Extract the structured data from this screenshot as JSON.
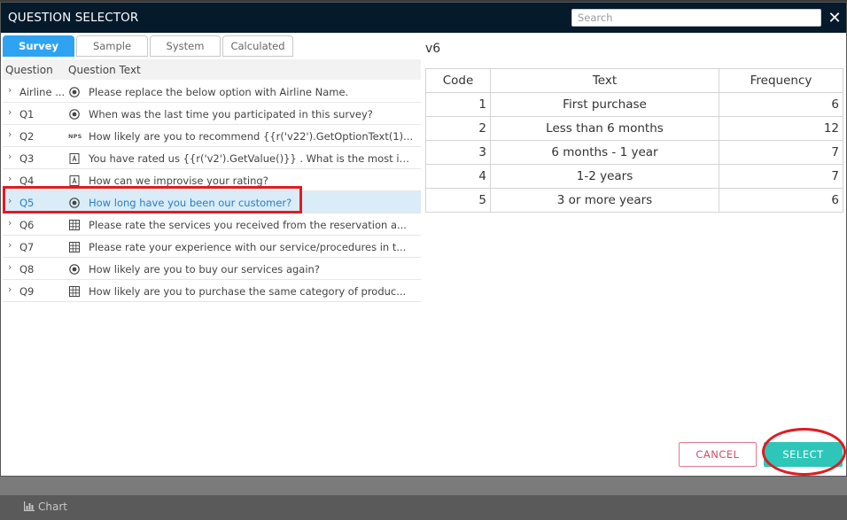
{
  "window": {
    "title": "QUESTION SELECTOR"
  },
  "search": {
    "placeholder": "Search",
    "value": ""
  },
  "close_icon": "close-icon",
  "tabs": [
    {
      "label": "Survey",
      "active": true
    },
    {
      "label": "Sample",
      "active": false
    },
    {
      "label": "System",
      "active": false
    },
    {
      "label": "Calculated",
      "active": false
    }
  ],
  "list": {
    "headers": {
      "question": "Question",
      "text": "Question Text"
    },
    "rows": [
      {
        "id": "Airline ...",
        "icon": "radio-icon",
        "text": "Please replace the below option with Airline Name."
      },
      {
        "id": "Q1",
        "icon": "radio-icon",
        "text": "When was the last time you participated in this survey?"
      },
      {
        "id": "Q2",
        "icon": "nps-icon",
        "icon_label": "NPS",
        "text": "How likely are you to recommend {{r('v22').GetOptionText(1)..."
      },
      {
        "id": "Q3",
        "icon": "text-field-icon",
        "text": "You have rated us {{r('v2').GetValue()}} . What is the most im..."
      },
      {
        "id": "Q4",
        "icon": "text-field-icon",
        "text": "How can we improvise your rating?"
      },
      {
        "id": "Q5",
        "icon": "radio-icon",
        "text": "How long have you been our customer?",
        "selected": true
      },
      {
        "id": "Q6",
        "icon": "grid-icon",
        "text": " Please rate the services you received from the reservation a..."
      },
      {
        "id": "Q7",
        "icon": "grid-icon",
        "text": "Please rate your experience with our service/procedures in t..."
      },
      {
        "id": "Q8",
        "icon": "radio-icon",
        "text": "How likely are you to buy our services again?"
      },
      {
        "id": "Q9",
        "icon": "grid-icon",
        "text": "How likely are you to purchase the same category of produc..."
      }
    ]
  },
  "detail": {
    "variable": "v6",
    "columns": [
      "Code",
      "Text",
      "Frequency"
    ],
    "rows": [
      {
        "code": "1",
        "text": "First purchase",
        "frequency": "6"
      },
      {
        "code": "2",
        "text": "Less than 6 months",
        "frequency": "12"
      },
      {
        "code": "3",
        "text": "6 months - 1 year",
        "frequency": "7"
      },
      {
        "code": "4",
        "text": "1-2 years",
        "frequency": "7"
      },
      {
        "code": "5",
        "text": "3 or more years",
        "frequency": "6"
      }
    ]
  },
  "footer": {
    "cancel_label": "CANCEL",
    "select_label": "SELECT"
  },
  "bottom_bar": {
    "chart_label": "Chart",
    "chart_icon": "bar-chart-icon"
  },
  "colors": {
    "header_bg": "#051a2b",
    "tab_active": "#2ea3f2",
    "select_button": "#2ec6b8",
    "cancel_border": "#e27a93",
    "annotation_red": "#e01b22",
    "selected_row_bg": "#d9ecf8"
  }
}
